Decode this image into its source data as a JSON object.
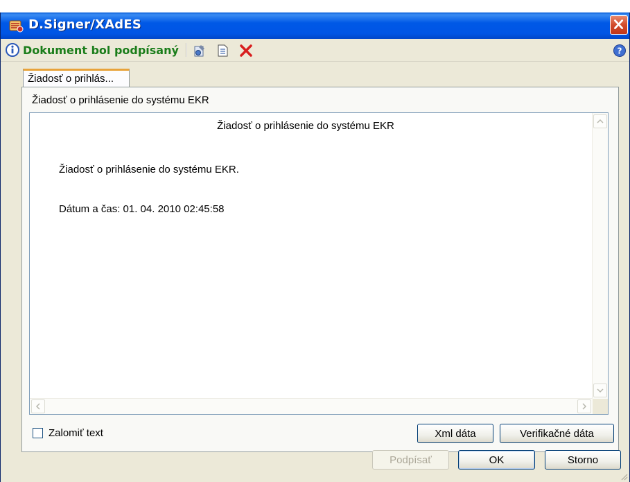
{
  "window": {
    "title": "D.Signer/XAdES"
  },
  "toolbar": {
    "status_text": "Dokument bol podpísaný"
  },
  "tab": {
    "label": "Žiadosť o prihlás..."
  },
  "document": {
    "title": "Žiadosť o prihlásenie do systému EKR",
    "heading": "Žiadosť o prihlásenie do systému EKR",
    "line1": "Žiadosť o prihlásenie do systému EKR.",
    "line2": "Dátum a čas: 01. 04. 2010 02:45:58"
  },
  "options": {
    "wrap_text_label": "Zalomiť text",
    "wrap_text_checked": false
  },
  "buttons": {
    "xml_data": "Xml dáta",
    "verification_data": "Verifikačné dáta",
    "sign": "Podpísať",
    "ok": "OK",
    "cancel": "Storno"
  },
  "icons": {
    "app": "app-icon",
    "info": "info-icon",
    "settings": "settings-icon",
    "document": "document-icon",
    "delete": "delete-icon",
    "help": "help-icon",
    "close": "close-icon"
  },
  "colors": {
    "title_bar": "#0055e5",
    "status_text": "#1a7d1a",
    "delete_icon": "#d81e1e",
    "tab_accent": "#e8a33a"
  }
}
